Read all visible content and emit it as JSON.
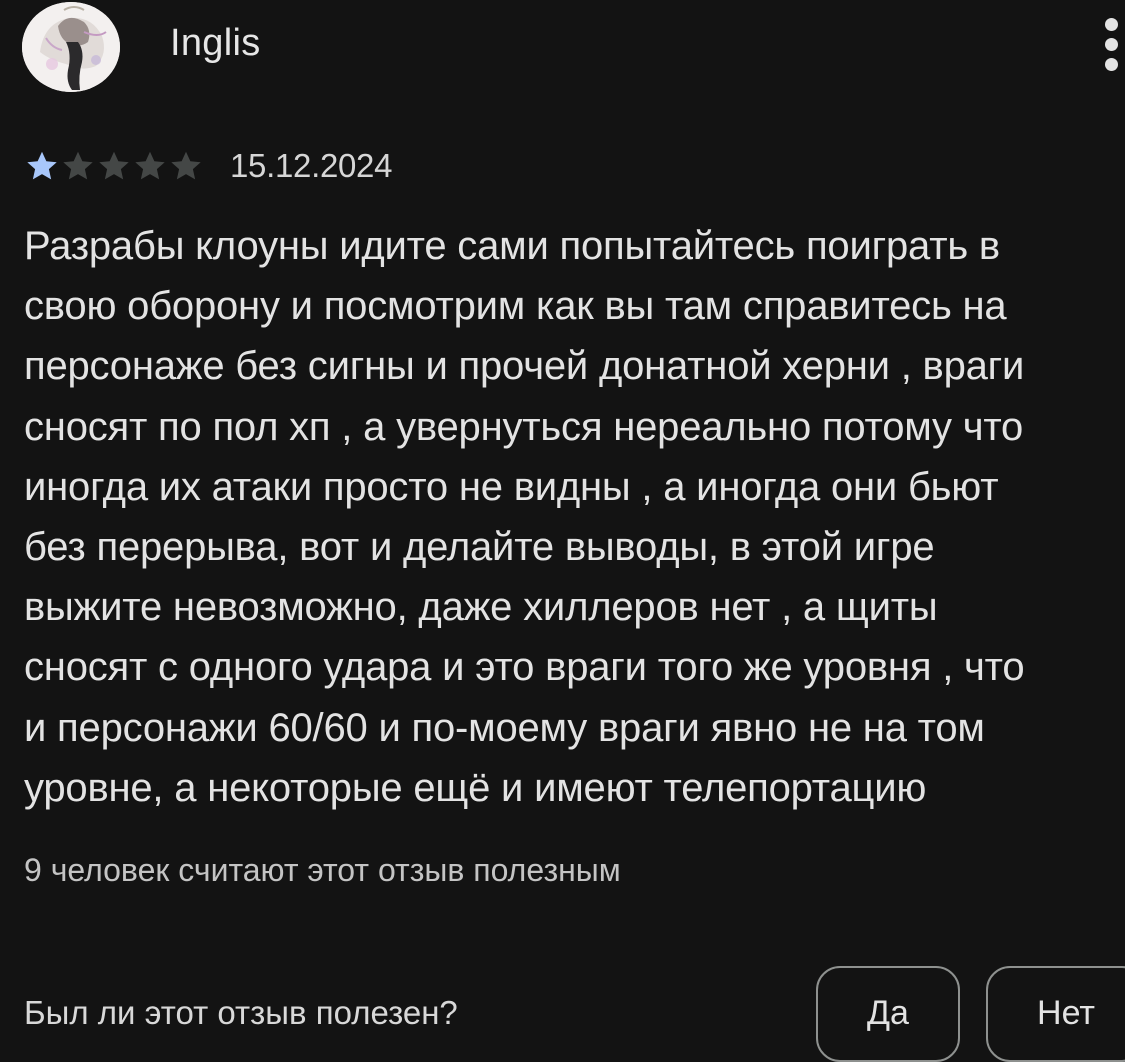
{
  "review": {
    "author": "Inglis",
    "rating": 1,
    "max_rating": 5,
    "date": "15.12.2024",
    "text_lines": [
      "Разрабы клоуны идите сами попытайтесь поиграть в",
      "свою оборону и посмотрим как вы там справитесь на",
      "персонаже без сигны и прочей донатной херни , враги",
      "сносят по пол хп , а увернуться нереально потому что",
      "иногда их атаки просто не видны , а иногда они бьют",
      "без перерыва, вот и делайте выводы, в этой игре",
      "выжите невозможно, даже хиллеров нет , а щиты",
      "сносят с одного удара и это враги того же уровня , что",
      "и персонажи 60/60 и по-моему враги явно не на том",
      "уровне, а некоторые ещё и имеют телепортацию"
    ],
    "helpful_count": "9 человек считают этот отзыв полезным"
  },
  "feedback": {
    "question": "Был ли этот отзыв полезен?",
    "yes_label": "Да",
    "no_label": "Нет"
  },
  "icons": {
    "avatar": "user-avatar-anime-character",
    "menu": "more-vert-icon",
    "star_filled": "star-filled-icon",
    "star_empty": "star-empty-icon"
  },
  "colors": {
    "background": "#131313",
    "text": "#e3e3e3",
    "star_filled": "#a8c7fa",
    "star_empty": "#444746",
    "button_border": "#8e918f"
  }
}
